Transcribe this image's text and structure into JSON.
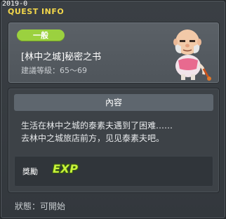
{
  "window": {
    "stamp": "2019-0",
    "title": "QUEST INFO"
  },
  "quest": {
    "category": "一般",
    "name": "[林中之城]秘密之书",
    "level": "建議等級：65～69"
  },
  "content": {
    "header": "內容",
    "lines": [
      "生活在林中之城的泰素夫遇到了困难……",
      "去林中之城旅店前方，见见泰素夫吧。"
    ]
  },
  "reward": {
    "label": "獎勵",
    "exp": "EXP"
  },
  "status": "狀態：可開始",
  "colors": {
    "title": "#f2d64b",
    "badge": "#9bd13f",
    "exp": "#c8f23a"
  },
  "icons": {
    "npc": "old-man-npc-icon",
    "exp": "exp-icon"
  }
}
